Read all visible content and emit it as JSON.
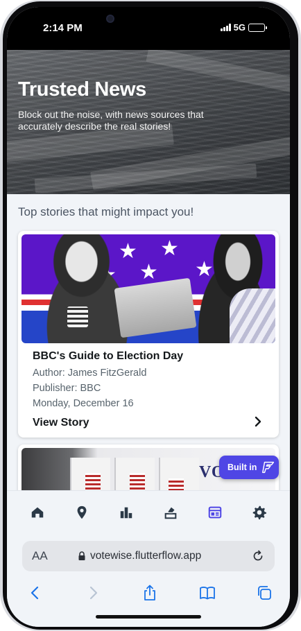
{
  "status_bar": {
    "time": "2:14 PM",
    "network": "5G"
  },
  "hero": {
    "title": "Trusted News",
    "subtitle": "Block out the noise, with news sources that accurately describe the real stories!"
  },
  "section_heading": "Top stories that might impact you!",
  "stories": [
    {
      "title": "BBC's Guide to Election Day",
      "author": "Author: James FitzGerald",
      "publisher": "Publisher: BBC",
      "date": "Monday, December 16",
      "action_label": "View Story"
    },
    {
      "image_text": "VOTE"
    }
  ],
  "badge": {
    "label": "Built in"
  },
  "bottom_nav": {
    "items": [
      {
        "icon": "home-icon",
        "active": false
      },
      {
        "icon": "map-pin-icon",
        "active": false
      },
      {
        "icon": "bar-chart-icon",
        "active": false
      },
      {
        "icon": "ballot-box-icon",
        "active": false
      },
      {
        "icon": "calendar-news-icon",
        "active": true
      },
      {
        "icon": "gear-icon",
        "active": false
      }
    ]
  },
  "browser": {
    "text_size_label": "AA",
    "url": "votewise.flutterflow.app"
  },
  "colors": {
    "accent": "#4f46e5",
    "nav_icon": "#2b3947",
    "text_primary": "#14181b",
    "text_secondary": "#57636c",
    "browser_blue": "#1a73e8"
  }
}
